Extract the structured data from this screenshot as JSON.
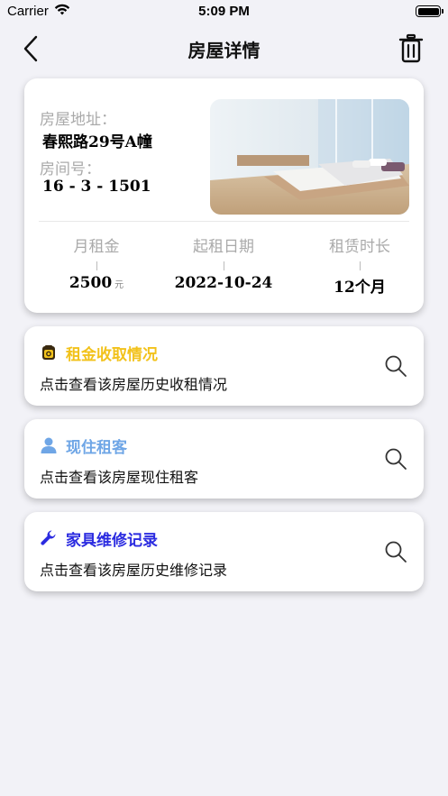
{
  "status_bar": {
    "carrier": "Carrier",
    "time": "5:09 PM"
  },
  "nav": {
    "title": "房屋详情",
    "back_icon": "chevron-left-icon",
    "delete_icon": "trash-icon"
  },
  "house": {
    "address_label": "房屋地址：",
    "address_value": "春熙路29号A幢",
    "room_label": "房间号：",
    "room_value": "16 - 3 - 1501",
    "stats": [
      {
        "label": "月租金",
        "value": "2500",
        "unit": "元"
      },
      {
        "label": "起租日期",
        "value": "2022-10-24"
      },
      {
        "label": "租赁时长",
        "value": "12个月"
      }
    ]
  },
  "sections": [
    {
      "title": "租金收取情况",
      "desc": "点击查看该房屋历史收租情况",
      "color": "#f2c21b",
      "icon": "money-bag-icon"
    },
    {
      "title": "现住租客",
      "desc": "点击查看该房屋现住租客",
      "color": "#6fa6e6",
      "icon": "person-icon"
    },
    {
      "title": "家具维修记录",
      "desc": "点击查看该房屋历史维修记录",
      "color": "#2b2be0",
      "icon": "wrench-icon"
    }
  ]
}
